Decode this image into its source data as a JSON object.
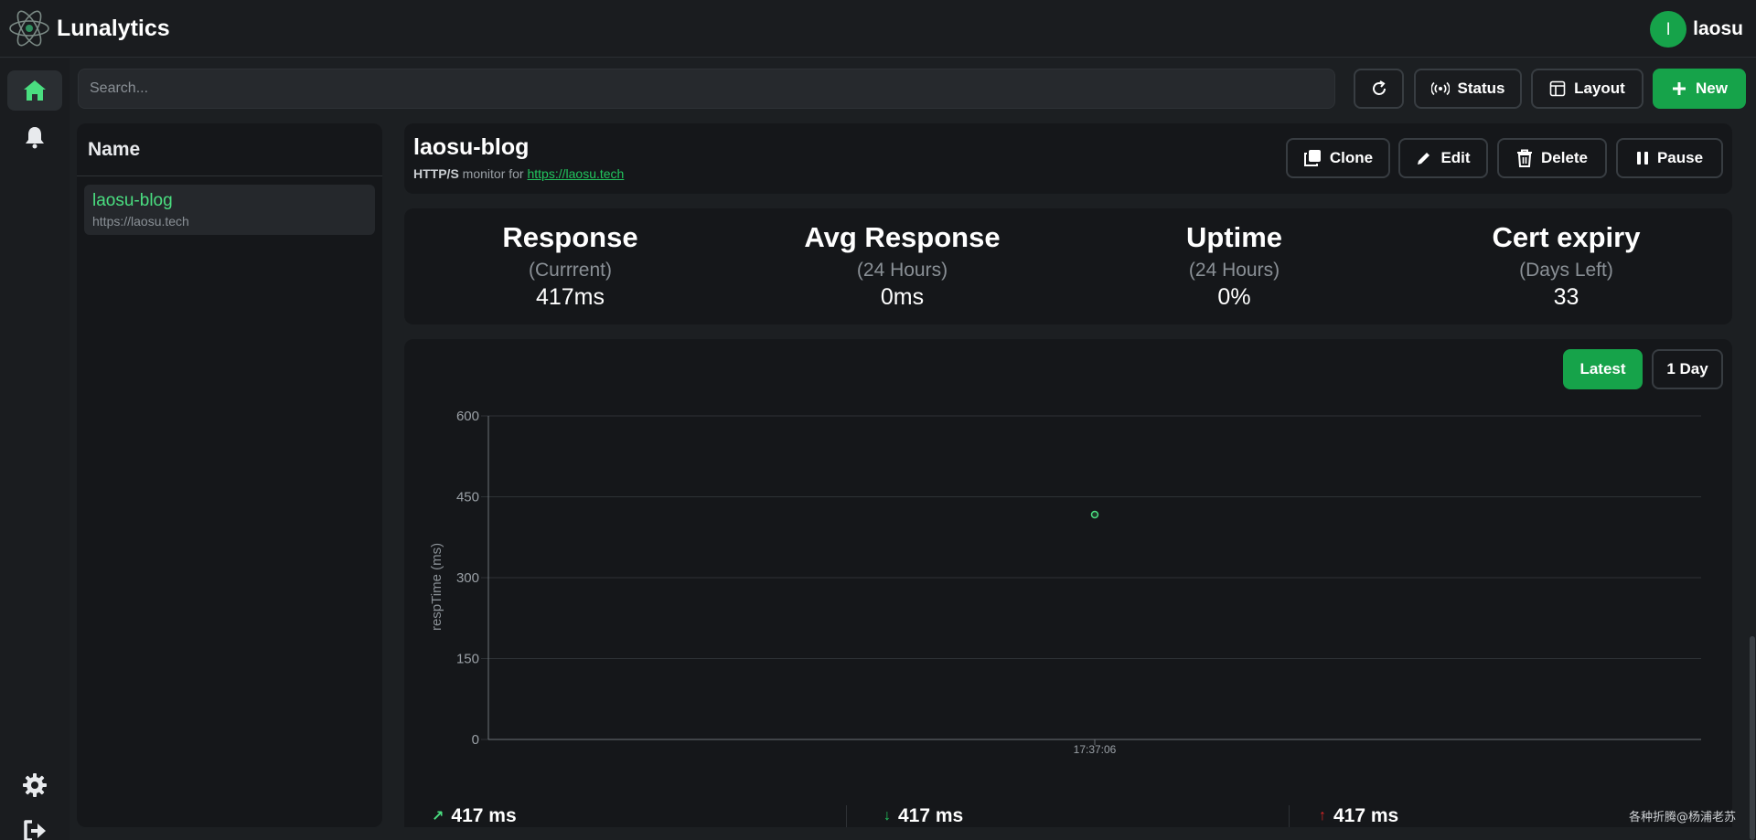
{
  "app": {
    "name": "Lunalytics"
  },
  "user": {
    "initial": "l",
    "name": "laosu"
  },
  "sidebar": {
    "items": [
      {
        "icon": "home-icon",
        "active": true
      },
      {
        "icon": "bell-icon",
        "active": false
      }
    ],
    "bottom_items": [
      {
        "icon": "gear-icon"
      },
      {
        "icon": "logout-icon"
      }
    ]
  },
  "search": {
    "placeholder": "Search...",
    "value": ""
  },
  "toolbar": {
    "status_label": "Status",
    "layout_label": "Layout",
    "new_label": "New"
  },
  "monitor_list": {
    "header": "Name",
    "items": [
      {
        "name": "laosu-blog",
        "url": "https://laosu.tech"
      }
    ]
  },
  "monitor": {
    "title": "laosu-blog",
    "type": "HTTP/S",
    "subtitle_middle": "monitor for",
    "url": "https://laosu.tech",
    "actions": {
      "clone": "Clone",
      "edit": "Edit",
      "delete": "Delete",
      "pause": "Pause"
    }
  },
  "stats": [
    {
      "title": "Response",
      "subtitle": "(Currrent)",
      "value": "417ms"
    },
    {
      "title": "Avg Response",
      "subtitle": "(24 Hours)",
      "value": "0ms"
    },
    {
      "title": "Uptime",
      "subtitle": "(24 Hours)",
      "value": "0%"
    },
    {
      "title": "Cert expiry",
      "subtitle": "(Days Left)",
      "value": "33"
    }
  ],
  "chart_controls": {
    "latest": "Latest",
    "day": "1 Day"
  },
  "chart_data": {
    "type": "scatter",
    "ylabel": "respTime (ms)",
    "xlabel": "",
    "ylim": [
      0,
      600
    ],
    "yticks": [
      "600",
      "450",
      "300",
      "150",
      "0"
    ],
    "x": [
      "17:37:06"
    ],
    "values": [
      417
    ],
    "grid": true,
    "color": "#4ade80"
  },
  "summary": [
    {
      "value": "417 ms",
      "color": "#4ade80"
    },
    {
      "value": "417 ms",
      "color": "#22c55e"
    },
    {
      "value": "417 ms",
      "color": "#dc2626"
    }
  ],
  "watermark": "各种折腾@杨浦老苏",
  "colors": {
    "accent": "#16a34a",
    "background": "#1c1f22",
    "panel": "#15171a"
  }
}
